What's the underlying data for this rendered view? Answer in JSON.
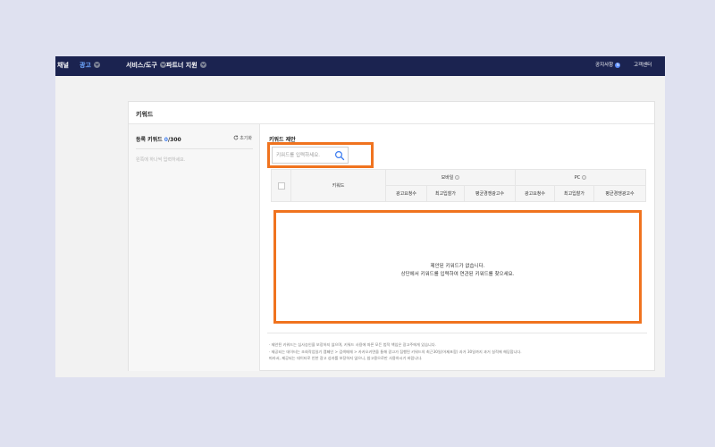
{
  "nav": {
    "items": [
      {
        "label": "채널",
        "active": false
      },
      {
        "label": "광고",
        "active": true
      },
      {
        "label": "서비스/도구",
        "active": false
      },
      {
        "label": "파트너 지원",
        "active": false
      }
    ],
    "notice_label": "공지사항",
    "notice_badge": "N",
    "support_label": "고객센터"
  },
  "card": {
    "title": "키워드"
  },
  "left_panel": {
    "title": "등록 키워드",
    "count": "0",
    "max": "/300",
    "reset_label": "초기화",
    "placeholder": "왼쪽에 하나씩 입력하세요."
  },
  "suggest": {
    "title": "키워드 제안",
    "search_placeholder": "키워드를 입력하세요."
  },
  "table": {
    "keyword_header": "키워드",
    "mobile_group": "모바일",
    "pc_group": "PC",
    "info_glyph": "i",
    "mobile_cols": [
      "광고요청수",
      "최고입찰가",
      "평균경쟁광고수"
    ],
    "pc_cols": [
      "광고요청수",
      "최고입찰가",
      "평균경쟁광고수"
    ]
  },
  "empty": {
    "line1": "제안된 키워드가 없습니다.",
    "line2": "상단에서 키워드를 입력하여 연관된 키워드를 찾으세요."
  },
  "notes": [
    "· 제안된 키워드는 심사승인을 보장하지 않으며, 키워드 사용에 따른 모든 법적 책임은 광고주에게 있습니다.",
    "· 제공되는 데이터는 조회작업일기 캠페인 > 검색매체 > 카카오키면을 통해 광고가 집행된 키워드의 최근30일(어제포함) 과거 30일까지 과거 실적에 해당합니다.",
    "  따라서, 제공되는 데이터로 인한 광고 성과를 보장하지 않으니, 참고용으로만 사용하시기 바랍니다."
  ],
  "colors": {
    "nav_bg": "#1b2350",
    "nav_active": "#6ea7ff",
    "highlight": "#f0731f",
    "accent": "#3a7bf0"
  }
}
